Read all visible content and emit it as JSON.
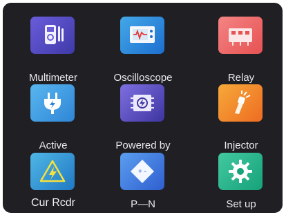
{
  "menu": {
    "items": [
      {
        "label": "Multimeter",
        "icon": "multimeter-icon",
        "color": "#5a4fd0"
      },
      {
        "label": "Oscilloscope",
        "icon": "oscilloscope-icon",
        "color": "#2f8ee0"
      },
      {
        "label": "Relay",
        "icon": "relay-icon",
        "color": "#ef6a6a"
      },
      {
        "label": "Active",
        "icon": "plug-icon",
        "color": "#3f98e2"
      },
      {
        "label": "Powered by",
        "icon": "power-chip-icon",
        "color": "#5c50c6"
      },
      {
        "label": "Injector",
        "icon": "injector-icon",
        "color": "#f28a2c"
      },
      {
        "label": "Cur Rcdr",
        "icon": "warning-bolt-icon",
        "color": "#3297d6"
      },
      {
        "label": "P—N",
        "icon": "pn-diode-icon",
        "color": "#447ee0"
      },
      {
        "label": "Set up",
        "icon": "gear-icon",
        "color": "#2ab58b"
      }
    ]
  }
}
